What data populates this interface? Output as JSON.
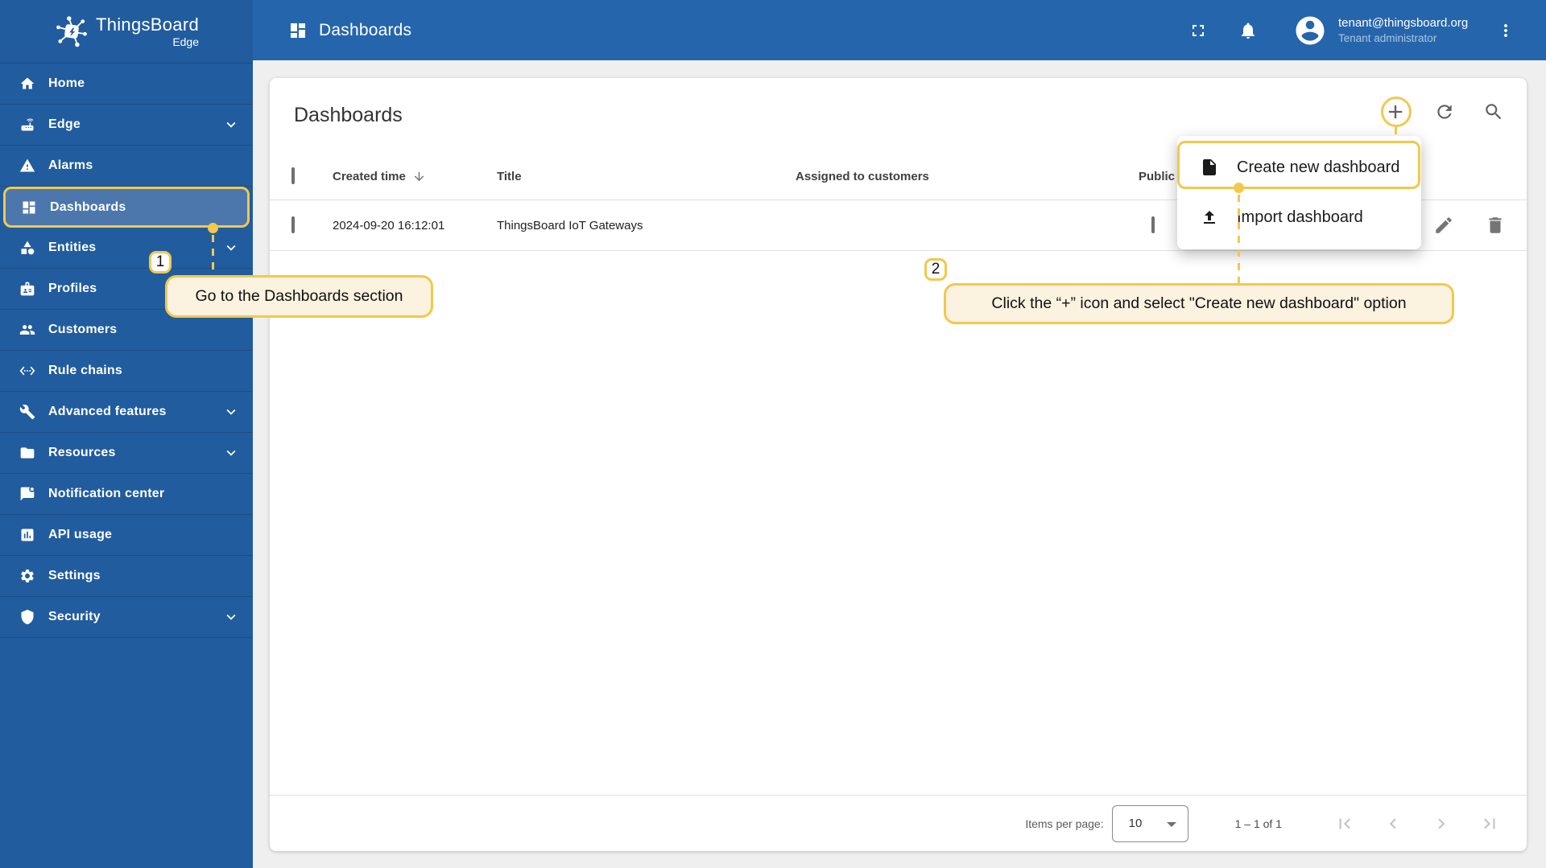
{
  "app": {
    "brand": "ThingsBoard",
    "brand_sub": "Edge"
  },
  "header": {
    "title": "Dashboards",
    "user_email": "tenant@thingsboard.org",
    "user_role": "Tenant administrator",
    "icons": [
      "fullscreen-icon",
      "notifications-bell-icon",
      "account-circle-icon",
      "more-vert-icon"
    ]
  },
  "sidebar": {
    "items": [
      {
        "label": "Home",
        "icon": "home-icon",
        "expandable": false,
        "selected": false
      },
      {
        "label": "Edge",
        "icon": "router-icon",
        "expandable": true,
        "selected": false
      },
      {
        "label": "Alarms",
        "icon": "warning-triangle-icon",
        "expandable": false,
        "selected": false
      },
      {
        "label": "Dashboards",
        "icon": "dashboards-grid-icon",
        "expandable": false,
        "selected": true
      },
      {
        "label": "Entities",
        "icon": "category-shapes-icon",
        "expandable": true,
        "selected": false
      },
      {
        "label": "Profiles",
        "icon": "badge-icon",
        "expandable": false,
        "selected": false
      },
      {
        "label": "Customers",
        "icon": "people-icon",
        "expandable": false,
        "selected": false
      },
      {
        "label": "Rule chains",
        "icon": "ethernet-code-icon",
        "expandable": false,
        "selected": false
      },
      {
        "label": "Advanced features",
        "icon": "wrench-icon",
        "expandable": true,
        "selected": false
      },
      {
        "label": "Resources",
        "icon": "folder-icon",
        "expandable": true,
        "selected": false
      },
      {
        "label": "Notification center",
        "icon": "notification-bubble-icon",
        "expandable": false,
        "selected": false
      },
      {
        "label": "API usage",
        "icon": "chart-box-icon",
        "expandable": false,
        "selected": false
      },
      {
        "label": "Settings",
        "icon": "gear-icon",
        "expandable": false,
        "selected": false
      },
      {
        "label": "Security",
        "icon": "shield-icon",
        "expandable": true,
        "selected": false
      }
    ]
  },
  "page": {
    "card_title": "Dashboards",
    "toolbar_icons": [
      "add-icon",
      "refresh-icon",
      "search-icon"
    ]
  },
  "table": {
    "columns": {
      "created": "Created time",
      "title": "Title",
      "assigned": "Assigned to customers",
      "public": "Public"
    },
    "sort_icon": "arrow-down-icon",
    "rows": [
      {
        "created_time": "2024-09-20 16:12:01",
        "title": "ThingsBoard IoT Gateways",
        "assigned": "",
        "public_checked": false
      }
    ],
    "row_actions": [
      "edit-pencil-icon",
      "delete-trash-icon"
    ]
  },
  "menu": {
    "items": [
      {
        "label": "Create new dashboard",
        "icon": "file-document-icon"
      },
      {
        "label": "Import dashboard",
        "icon": "upload-icon"
      }
    ]
  },
  "paginator": {
    "items_per_page_label": "Items per page:",
    "items_per_page_value": "10",
    "range": "1 – 1 of 1",
    "nav_icons": [
      "first-page-icon",
      "prev-page-icon",
      "next-page-icon",
      "last-page-icon"
    ]
  },
  "annotations": {
    "step1": {
      "number": "1",
      "text": "Go to the Dashboards section"
    },
    "step2": {
      "number": "2",
      "text": "Click the “+” icon and select \"Create new dashboard\" option"
    }
  },
  "colors": {
    "accent_yellow": "#F2C84D",
    "sidebar_blue": "#215C9E",
    "header_blue": "#2565AC",
    "selected_item_blue": "#4B77AD",
    "callout_bg": "#FBF2DF"
  }
}
